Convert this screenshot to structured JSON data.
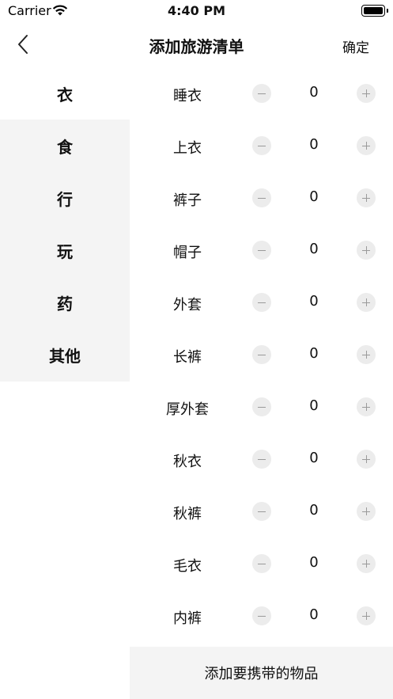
{
  "status_bar": {
    "carrier": "Carrier",
    "time": "4:40 PM"
  },
  "nav": {
    "title": "添加旅游清单",
    "confirm_label": "确定"
  },
  "categories": [
    {
      "label": "衣",
      "active": true
    },
    {
      "label": "食",
      "active": false
    },
    {
      "label": "行",
      "active": false
    },
    {
      "label": "玩",
      "active": false
    },
    {
      "label": "药",
      "active": false
    },
    {
      "label": "其他",
      "active": false
    }
  ],
  "items": [
    {
      "name": "睡衣",
      "quantity": "0"
    },
    {
      "name": "上衣",
      "quantity": "0"
    },
    {
      "name": "裤子",
      "quantity": "0"
    },
    {
      "name": "帽子",
      "quantity": "0"
    },
    {
      "name": "外套",
      "quantity": "0"
    },
    {
      "name": "长裤",
      "quantity": "0"
    },
    {
      "name": "厚外套",
      "quantity": "0"
    },
    {
      "name": "秋衣",
      "quantity": "0"
    },
    {
      "name": "秋裤",
      "quantity": "0"
    },
    {
      "name": "毛衣",
      "quantity": "0"
    },
    {
      "name": "内裤",
      "quantity": "0"
    }
  ],
  "add_button_label": "添加要携带的物品"
}
